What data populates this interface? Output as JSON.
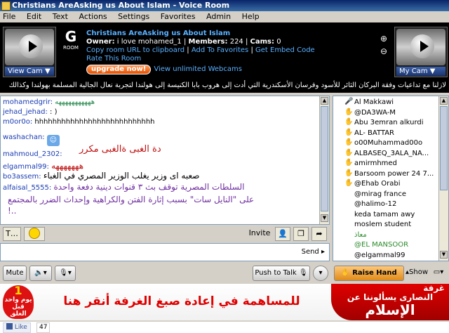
{
  "window": {
    "title": "Christians AreAsking us About Islam - Voice Room"
  },
  "menu": [
    "File",
    "Edit",
    "Text",
    "Actions",
    "Settings",
    "Favorites",
    "Admin",
    "Help"
  ],
  "room": {
    "g_letter": "G",
    "room_label": "ROOM",
    "name": "Christians AreAsking us About Islam",
    "owner_label": "Owner:",
    "owner": "i love mohamed_1",
    "members_label": "Members:",
    "members": "224",
    "cams_label": "Cams:",
    "cams": "0",
    "link1": "Copy room URL to clipboard",
    "link2": "Add To Favorites",
    "link3": "Get Embed Code",
    "link4": "Rate This Room",
    "upgrade": "upgrade now!",
    "webcams": "View unlimited Webcams"
  },
  "cams": {
    "left_label": "View Cam",
    "right_label": "My Cam"
  },
  "ticker": "لازلنا مع تداعيات وفقة البركان الثائر للأسود وفرسان الأسكندرية التي أدت إلى هروب بابا الكنيسة إلى هولندا لتجربة نعال الجالية المسلمة بهولندا وكذالك",
  "chat": [
    {
      "name": "mohamedgrir:",
      "text": "هههههههههههه",
      "color": "#2a8a50"
    },
    {
      "name": "jehad_jehad:",
      "text": ": )",
      "color": "#000000"
    },
    {
      "name": "m0or0o:",
      "text": "hhhhhhhhhhhhhhhhhhhhhhhhhhh",
      "color": "#000000"
    },
    {
      "name": "washachan:",
      "text": "",
      "color": "#000000"
    },
    {
      "name": "",
      "text": "دة الغبى ةالغبى مكرر",
      "color": "#c01010"
    },
    {
      "name": "mahmoud_2302:",
      "text": "",
      "color": "#000000"
    },
    {
      "name": "elgammal99:",
      "text": "هههههههه",
      "color": "#c01010"
    },
    {
      "name": "bo3assem:",
      "text": "صعبه اى وزير يغلب الوزير المصري في الغباء",
      "color": "#000000"
    },
    {
      "name": "alfaisal_5555:",
      "text": "السلطات المصرية توقف بث ٣ قنوات دينية دفعة واحدة",
      "color": "#7030a0"
    },
    {
      "name": "",
      "text": "على \"النايل سات\" بسبب إثارة الفتن والكراهية وإحداث الضرر بالمجتمع",
      "color": "#7030a0"
    },
    {
      "name": "",
      "text": "!..",
      "color": "#7030a0"
    }
  ],
  "toolbar": {
    "text_btn": "T",
    "invite": "Invite"
  },
  "compose": {
    "send": "Send"
  },
  "bottom": {
    "mute": "Mute",
    "push_to_talk": "Push to Talk",
    "raise_hand": "Raise Hand",
    "show": "Show"
  },
  "users": [
    {
      "name": "Al Makkawi",
      "icon": "🎤",
      "color": "#000000"
    },
    {
      "name": "@DA3WA-M",
      "icon": "✋",
      "color": "#000000"
    },
    {
      "name": "Abu 3emran alkurdi",
      "icon": "✋",
      "color": "#000000"
    },
    {
      "name": "AL- BATTAR",
      "icon": "✋",
      "color": "#000000"
    },
    {
      "name": "o00Muhammad00o",
      "icon": "✋",
      "color": "#000000"
    },
    {
      "name": "ALBASEQ_3ALA_NA...",
      "icon": "✋",
      "color": "#000000"
    },
    {
      "name": "amirmhmed",
      "icon": "✋",
      "color": "#000000"
    },
    {
      "name": "Barsoom power 24 7...",
      "icon": "✋",
      "color": "#000000"
    },
    {
      "name": "@Ehab Orabi",
      "icon": "✋",
      "color": "#000000"
    },
    {
      "name": "@mirag france",
      "icon": "",
      "color": "#000000"
    },
    {
      "name": "@halimo-12",
      "icon": "",
      "color": "#000000"
    },
    {
      "name": "keda tamam awy",
      "icon": "",
      "color": "#000000"
    },
    {
      "name": "moslem student",
      "icon": "",
      "color": "#000000"
    },
    {
      "name": "معاذ",
      "icon": "",
      "color": "#2a8a2a"
    },
    {
      "name": "@EL MANSOOR",
      "icon": "",
      "color": "#2a8a2a"
    },
    {
      "name": "@elgammal99",
      "icon": "",
      "color": "#000000"
    }
  ],
  "banner": {
    "badge_num": "1",
    "badge_text": "يوم واحد قبل الغلق",
    "main": "للمساهمة في إعادة صبغ الغرفة أنقر هنا",
    "right_top": "غرفة",
    "right_mid": "النصارى يسألوننا عن",
    "right_big": "الإسلام"
  },
  "facebook": {
    "like": "Like",
    "count": "47"
  }
}
